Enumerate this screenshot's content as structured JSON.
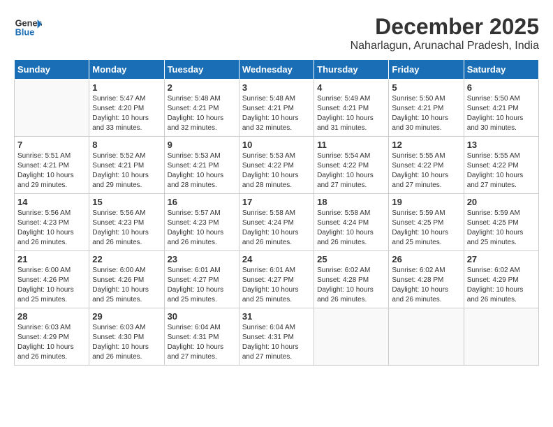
{
  "logo": {
    "line1": "General",
    "line2": "Blue"
  },
  "title": "December 2025",
  "subtitle": "Naharlagun, Arunachal Pradesh, India",
  "days_of_week": [
    "Sunday",
    "Monday",
    "Tuesday",
    "Wednesday",
    "Thursday",
    "Friday",
    "Saturday"
  ],
  "weeks": [
    [
      {
        "day": "",
        "info": ""
      },
      {
        "day": "1",
        "sunrise": "5:47 AM",
        "sunset": "4:20 PM",
        "daylight": "10 hours and 33 minutes."
      },
      {
        "day": "2",
        "sunrise": "5:48 AM",
        "sunset": "4:21 PM",
        "daylight": "10 hours and 32 minutes."
      },
      {
        "day": "3",
        "sunrise": "5:48 AM",
        "sunset": "4:21 PM",
        "daylight": "10 hours and 32 minutes."
      },
      {
        "day": "4",
        "sunrise": "5:49 AM",
        "sunset": "4:21 PM",
        "daylight": "10 hours and 31 minutes."
      },
      {
        "day": "5",
        "sunrise": "5:50 AM",
        "sunset": "4:21 PM",
        "daylight": "10 hours and 30 minutes."
      },
      {
        "day": "6",
        "sunrise": "5:50 AM",
        "sunset": "4:21 PM",
        "daylight": "10 hours and 30 minutes."
      }
    ],
    [
      {
        "day": "7",
        "sunrise": "5:51 AM",
        "sunset": "4:21 PM",
        "daylight": "10 hours and 29 minutes."
      },
      {
        "day": "8",
        "sunrise": "5:52 AM",
        "sunset": "4:21 PM",
        "daylight": "10 hours and 29 minutes."
      },
      {
        "day": "9",
        "sunrise": "5:53 AM",
        "sunset": "4:21 PM",
        "daylight": "10 hours and 28 minutes."
      },
      {
        "day": "10",
        "sunrise": "5:53 AM",
        "sunset": "4:22 PM",
        "daylight": "10 hours and 28 minutes."
      },
      {
        "day": "11",
        "sunrise": "5:54 AM",
        "sunset": "4:22 PM",
        "daylight": "10 hours and 27 minutes."
      },
      {
        "day": "12",
        "sunrise": "5:55 AM",
        "sunset": "4:22 PM",
        "daylight": "10 hours and 27 minutes."
      },
      {
        "day": "13",
        "sunrise": "5:55 AM",
        "sunset": "4:22 PM",
        "daylight": "10 hours and 27 minutes."
      }
    ],
    [
      {
        "day": "14",
        "sunrise": "5:56 AM",
        "sunset": "4:23 PM",
        "daylight": "10 hours and 26 minutes."
      },
      {
        "day": "15",
        "sunrise": "5:56 AM",
        "sunset": "4:23 PM",
        "daylight": "10 hours and 26 minutes."
      },
      {
        "day": "16",
        "sunrise": "5:57 AM",
        "sunset": "4:23 PM",
        "daylight": "10 hours and 26 minutes."
      },
      {
        "day": "17",
        "sunrise": "5:58 AM",
        "sunset": "4:24 PM",
        "daylight": "10 hours and 26 minutes."
      },
      {
        "day": "18",
        "sunrise": "5:58 AM",
        "sunset": "4:24 PM",
        "daylight": "10 hours and 26 minutes."
      },
      {
        "day": "19",
        "sunrise": "5:59 AM",
        "sunset": "4:25 PM",
        "daylight": "10 hours and 25 minutes."
      },
      {
        "day": "20",
        "sunrise": "5:59 AM",
        "sunset": "4:25 PM",
        "daylight": "10 hours and 25 minutes."
      }
    ],
    [
      {
        "day": "21",
        "sunrise": "6:00 AM",
        "sunset": "4:26 PM",
        "daylight": "10 hours and 25 minutes."
      },
      {
        "day": "22",
        "sunrise": "6:00 AM",
        "sunset": "4:26 PM",
        "daylight": "10 hours and 25 minutes."
      },
      {
        "day": "23",
        "sunrise": "6:01 AM",
        "sunset": "4:27 PM",
        "daylight": "10 hours and 25 minutes."
      },
      {
        "day": "24",
        "sunrise": "6:01 AM",
        "sunset": "4:27 PM",
        "daylight": "10 hours and 25 minutes."
      },
      {
        "day": "25",
        "sunrise": "6:02 AM",
        "sunset": "4:28 PM",
        "daylight": "10 hours and 26 minutes."
      },
      {
        "day": "26",
        "sunrise": "6:02 AM",
        "sunset": "4:28 PM",
        "daylight": "10 hours and 26 minutes."
      },
      {
        "day": "27",
        "sunrise": "6:02 AM",
        "sunset": "4:29 PM",
        "daylight": "10 hours and 26 minutes."
      }
    ],
    [
      {
        "day": "28",
        "sunrise": "6:03 AM",
        "sunset": "4:29 PM",
        "daylight": "10 hours and 26 minutes."
      },
      {
        "day": "29",
        "sunrise": "6:03 AM",
        "sunset": "4:30 PM",
        "daylight": "10 hours and 26 minutes."
      },
      {
        "day": "30",
        "sunrise": "6:04 AM",
        "sunset": "4:31 PM",
        "daylight": "10 hours and 27 minutes."
      },
      {
        "day": "31",
        "sunrise": "6:04 AM",
        "sunset": "4:31 PM",
        "daylight": "10 hours and 27 minutes."
      },
      {
        "day": "",
        "info": ""
      },
      {
        "day": "",
        "info": ""
      },
      {
        "day": "",
        "info": ""
      }
    ]
  ]
}
